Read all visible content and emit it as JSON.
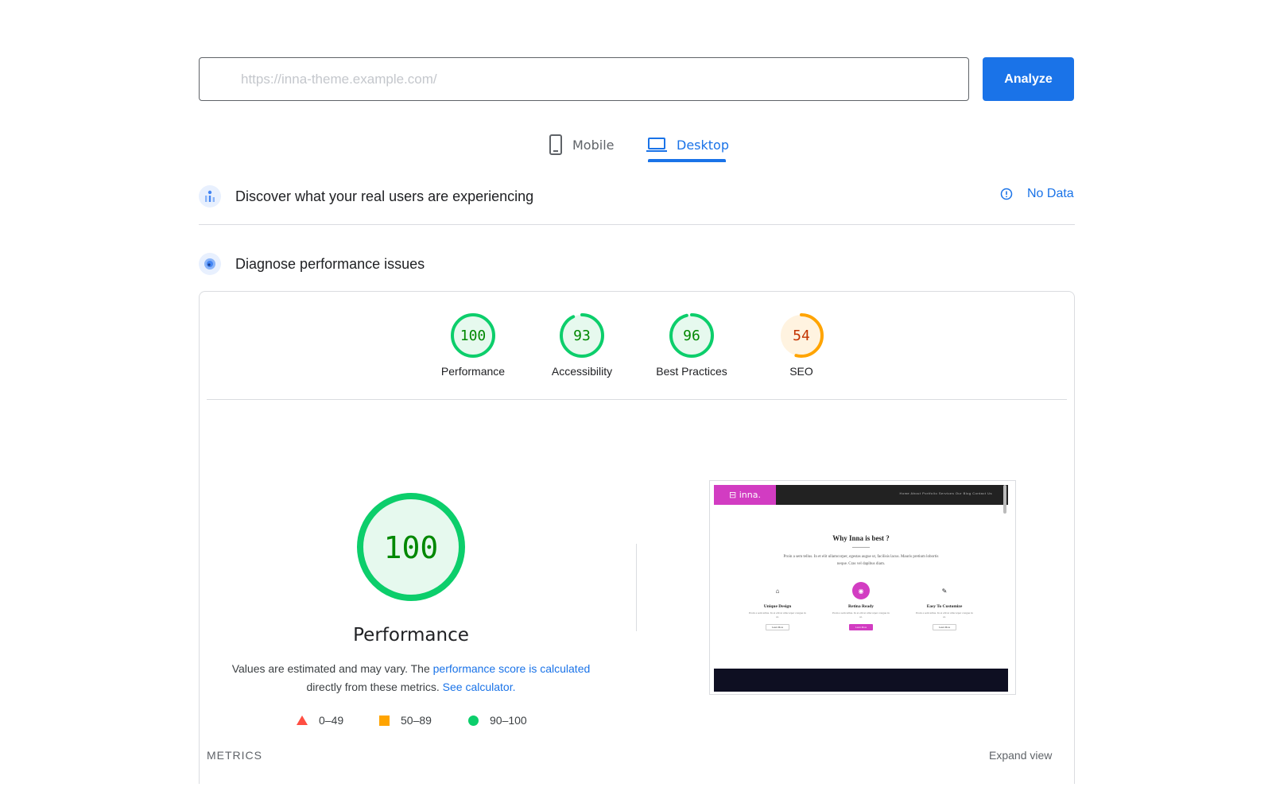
{
  "search": {
    "url_value": "https://inna-theme.example.com/",
    "analyze_label": "Analyze"
  },
  "tabs": [
    {
      "label": "Mobile",
      "icon": "smartphone-icon",
      "active": false
    },
    {
      "label": "Desktop",
      "icon": "laptop-icon",
      "active": true
    }
  ],
  "field_data": {
    "title": "Discover what your real users are experiencing",
    "status_label": "No Data"
  },
  "lab_data": {
    "title": "Diagnose performance issues"
  },
  "categories": [
    {
      "label": "Performance",
      "score": "100",
      "value": 100,
      "rating": "pass"
    },
    {
      "label": "Accessibility",
      "score": "93",
      "value": 93,
      "rating": "pass"
    },
    {
      "label": "Best Practices",
      "score": "96",
      "value": 96,
      "rating": "pass"
    },
    {
      "label": "SEO",
      "score": "54",
      "value": 54,
      "rating": "average"
    }
  ],
  "colors": {
    "pass": "#0cce6b",
    "pass_text": "#008800",
    "pass_bg": "#e6f9ee",
    "average": "#ffa400",
    "average_text": "#c33300",
    "average_bg": "#fff3e0",
    "fail": "#ff4e42",
    "accent": "#1a73e8"
  },
  "performance": {
    "score": "100",
    "value": 100,
    "title": "Performance",
    "desc_prefix": "Values are estimated and may vary. The ",
    "desc_link1": "performance score is calculated",
    "desc_middle": " directly from these metrics. ",
    "desc_link2": "See calculator."
  },
  "legend": [
    {
      "range": "0–49",
      "shape": "triangle"
    },
    {
      "range": "50–89",
      "shape": "square"
    },
    {
      "range": "90–100",
      "shape": "circle"
    }
  ],
  "metrics": {
    "label": "METRICS",
    "expand_label": "Expand view"
  },
  "thumbnail": {
    "logo": "⊟ inna.",
    "menu": "Home   About   Portfolio   Services   Our Blog   Contact Us",
    "heading": "Why Inna is best ?",
    "text": "Proin a sem tellus. In et elit ullamcorper, egestas augue ut, facilisis lacus. Mauris pretium lobortis neque. Cras vel dapibus diam.",
    "features": [
      {
        "title": "Unique Design",
        "icon": "home-icon",
        "text": "Proin a sem tellus. In et elit ut ullacorper congue in ut.",
        "button": "Learn More"
      },
      {
        "title": "Retina Ready",
        "icon": "eye-icon",
        "text": "Proin a sem tellus. In et elit ut ullacorper congue in ut.",
        "button": "Learn More"
      },
      {
        "title": "Easy To Customize",
        "icon": "pencil-icon",
        "text": "Proin a sem tellus. In et elit ut ullacorper congue in ut.",
        "button": "Learn More"
      }
    ]
  }
}
